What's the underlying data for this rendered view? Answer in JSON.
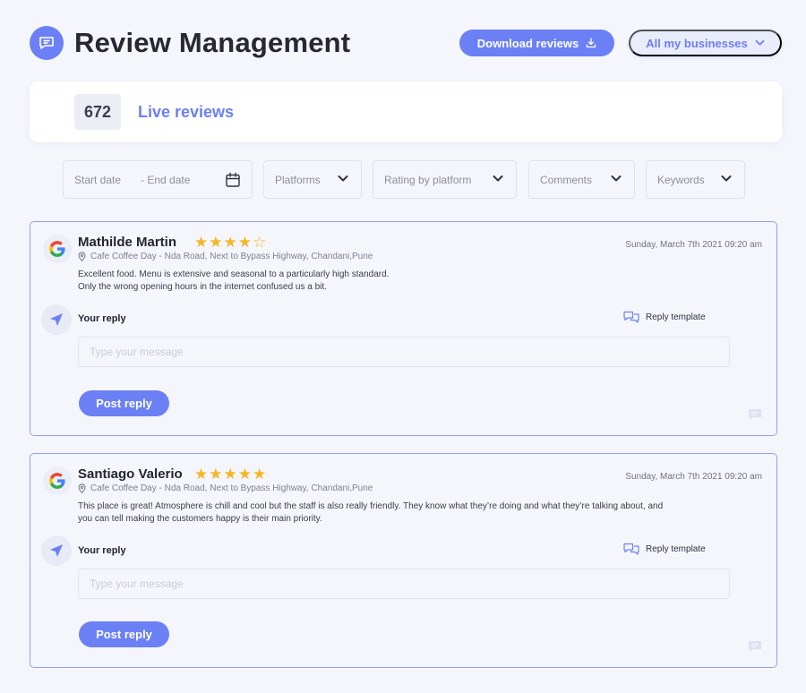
{
  "header": {
    "title": "Review Management",
    "download_label": "Download reviews",
    "business_label": "All my businesses"
  },
  "summary": {
    "count": "672",
    "label": "Live reviews"
  },
  "filters": {
    "start_date": "Start date",
    "end_date": "- End date",
    "platforms": "Platforms",
    "rating": "Rating by platform",
    "comments": "Comments",
    "keywords": "Keywords"
  },
  "reviews": [
    {
      "name": "Mathilde Martin",
      "rating": 4,
      "stars": "★★★★☆",
      "date": "Sunday, March 7th 2021 09:20 am",
      "location": "Cafe Coffee Day - Nda Road, Next to Bypass Highway, Chandani,Pune",
      "text_line1": "Excellent food. Menu is extensive and seasonal to a particularly high standard.",
      "text_line2": "Only the wrong opening hours in the internet confused us a bit.",
      "reply_label": "Your reply",
      "template_label": "Reply template",
      "placeholder": "Type your message",
      "post_label": "Post reply"
    },
    {
      "name": "Santiago Valerio",
      "rating": 5,
      "stars": "★★★★★",
      "date": "Sunday, March 7th 2021 09:20 am",
      "location": "Cafe Coffee Day - Nda Road, Next to Bypass Highway, Chandani,Pune",
      "text_line1": "This place is great! Atmosphere is chill and cool but the staff is also really friendly. They know what they’re doing and what they’re talking about, and",
      "text_line2": "you can tell making the customers happy is their main priority.",
      "reply_label": "Your reply",
      "template_label": "Reply template",
      "placeholder": "Type your message",
      "post_label": "Post reply"
    }
  ],
  "colors": {
    "accent": "#6c80f5",
    "star": "#f5b623",
    "background": "#f5f6fc"
  }
}
